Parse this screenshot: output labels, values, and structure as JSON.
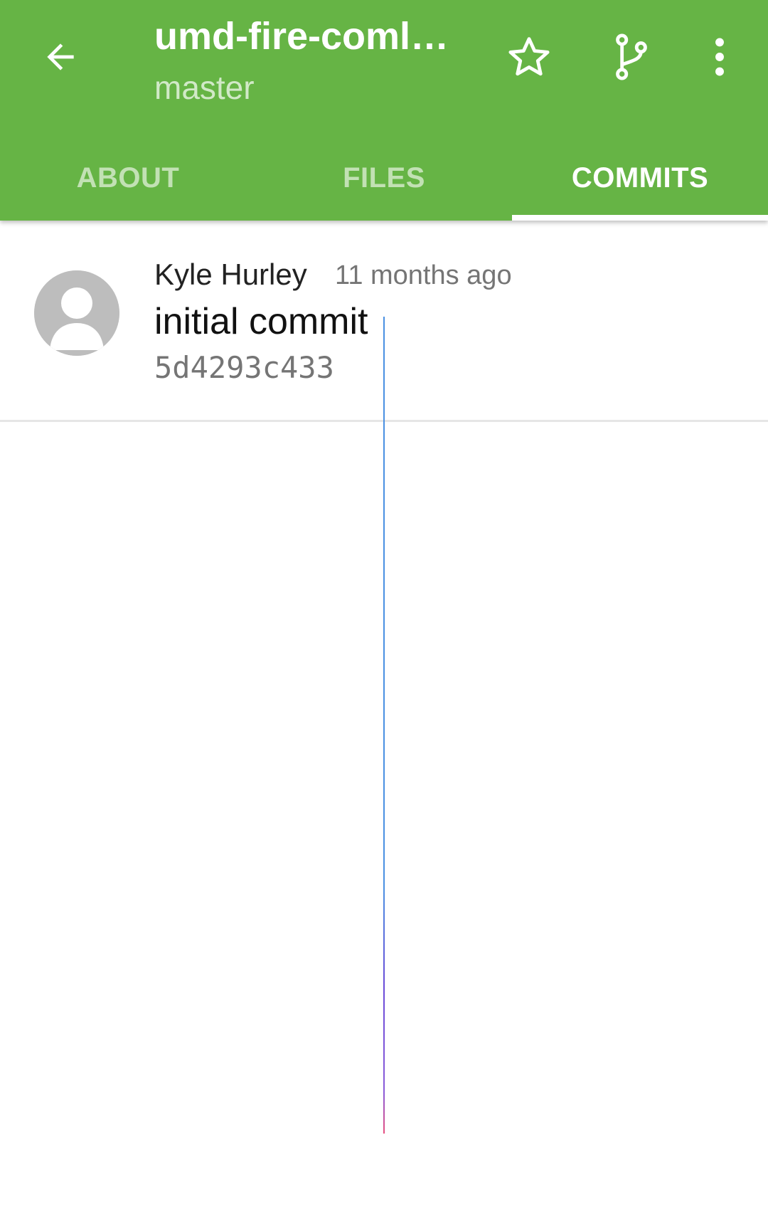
{
  "appbar": {
    "title": "umd-fire-coml…",
    "subtitle": "master",
    "accent_color": "#66b445",
    "icons": [
      "arrow-back-icon",
      "star-outline-icon",
      "git-branch-icon",
      "more-vert-icon"
    ]
  },
  "tabs": [
    {
      "label": "ABOUT",
      "active": false
    },
    {
      "label": "FILES",
      "active": false
    },
    {
      "label": "COMMITS",
      "active": true
    }
  ],
  "commits": [
    {
      "author": "Kyle Hurley",
      "time": "11 months ago",
      "message": "initial commit",
      "hash": "5d4293c433",
      "avatar": "default-avatar-icon"
    }
  ]
}
